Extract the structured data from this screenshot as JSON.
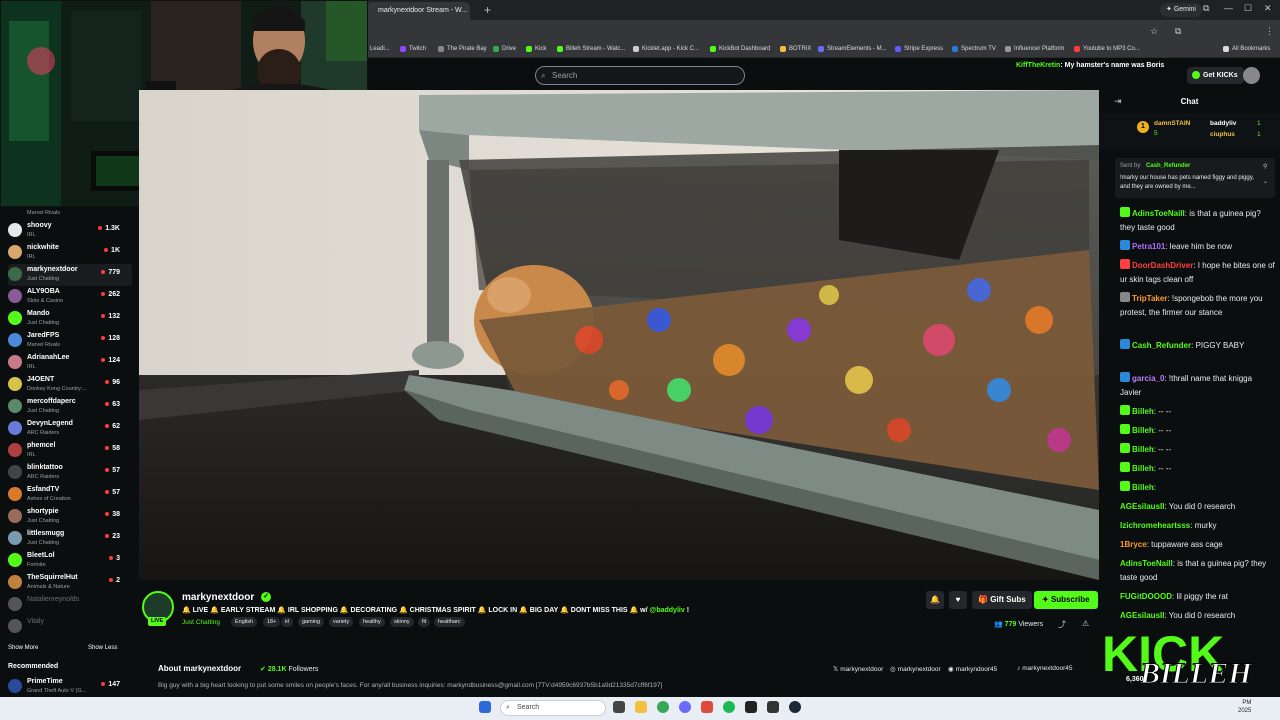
{
  "browser": {
    "tab_title": "markynextdoor Stream - W...",
    "gemini_label": "Gemini",
    "bookmarks": [
      "Leadi...",
      "Twitch",
      "The Pirate Bay",
      "Drive",
      "Kick",
      "Billeh Stream - Watc...",
      "Kicklet.app - Kick C...",
      "KickBot Dashboard",
      "BOTRIX",
      "StreamElements - M...",
      "Stripe Express",
      "Spectrum TV",
      "Influencer Platform",
      "Youtube to MP3 Co...",
      "All Bookmarks"
    ]
  },
  "kick": {
    "search_placeholder": "Search",
    "get_kicks": "Get KICKs",
    "banner_user": "KiffTheKretin",
    "banner_text": ": My hamster's name was Boris"
  },
  "sidebar": {
    "partial_category": "Marvel Rivals",
    "channels": [
      {
        "name": "shoovy",
        "category": "IRL",
        "viewers": "1.3K",
        "color": "#e8e8e8"
      },
      {
        "name": "nickwhite",
        "category": "IRL",
        "viewers": "1K",
        "color": "#d9a66b"
      },
      {
        "name": "markynextdoor",
        "category": "Just Chatting",
        "viewers": "779",
        "color": "#3a6a4a",
        "active": true
      },
      {
        "name": "ALY9OBA",
        "category": "Slots & Casino",
        "viewers": "262",
        "color": "#8a5a9a"
      },
      {
        "name": "Mando",
        "category": "Just Chatting",
        "viewers": "132",
        "color": "#53fc18"
      },
      {
        "name": "JaredFPS",
        "category": "Marvel Rivals",
        "viewers": "128",
        "color": "#4a8ad9"
      },
      {
        "name": "AdrianahLee",
        "category": "IRL",
        "viewers": "124",
        "color": "#c97a8a"
      },
      {
        "name": "J4OENT",
        "category": "Donkey Kong Country:...",
        "viewers": "96",
        "color": "#d9c24a"
      },
      {
        "name": "mercoffdaperc",
        "category": "Just Chatting",
        "viewers": "63",
        "color": "#5a8a6a"
      },
      {
        "name": "DevynLegend",
        "category": "ARC Raiders",
        "viewers": "62",
        "color": "#6a7ad9"
      },
      {
        "name": "phemcel",
        "category": "IRL",
        "viewers": "58",
        "color": "#b04040"
      },
      {
        "name": "blinktattoo",
        "category": "ARC Raiders",
        "viewers": "57",
        "color": "#444"
      },
      {
        "name": "EsfandTV",
        "category": "Ashes of Creation",
        "viewers": "57",
        "color": "#d97a2a"
      },
      {
        "name": "shortypie",
        "category": "Just Chatting",
        "viewers": "38",
        "color": "#9a6a5a"
      },
      {
        "name": "littlesmugg",
        "category": "Just Chatting",
        "viewers": "23",
        "color": "#7a9ab0"
      },
      {
        "name": "BleetLol",
        "category": "Fortnite",
        "viewers": "3",
        "color": "#53fc18"
      },
      {
        "name": "TheSquirrelHut",
        "category": "Animals & Nature",
        "viewers": "2",
        "color": "#c08040"
      },
      {
        "name": "Natalienreynolds",
        "category": "",
        "viewers": "",
        "color": "#555",
        "offline": true
      },
      {
        "name": "Vitaly",
        "category": "",
        "viewers": "",
        "color": "#555",
        "offline": true
      }
    ],
    "show_more": "Show More",
    "show_less": "Show Less",
    "recommended_title": "Recommended",
    "recommended": [
      {
        "name": "PrimeTime",
        "category": "Grand Theft Auto V (G...",
        "viewers": "147",
        "color": "#2a4a9a"
      }
    ]
  },
  "stream": {
    "username": "markynextdoor",
    "title": "🔔 LIVE 🔔 EARLY STREAM 🔔 IRL SHOPPING 🔔 DECORATING 🔔 CHRISTMAS SPIRIT 🔔 LOCK IN 🔔 BIG DAY 🔔 DONT MISS THIS 🔔 w/",
    "title_mention": "@baddyliv",
    "title_end": " !",
    "category": "Just Chatting",
    "tags": [
      "English",
      "18+",
      "irl",
      "gaming",
      "variety",
      "healthy",
      "skinny",
      "fit",
      "healtharc"
    ],
    "live_badge": "LIVE",
    "gift_subs": "Gift Subs",
    "subscribe": "Subscribe",
    "viewers_count": "779",
    "viewers_label": "Viewers"
  },
  "about": {
    "title": "About markynextdoor",
    "followers": "28.1K",
    "followers_label": "Followers",
    "bio": "Big guy with a big heart looking to put some smiles on people's faces. For any/all business inquiries: markyndbusiness@gmail.com [7TV:d4959c6937b5b1a9d21335d7cff6f197]",
    "socials": [
      "markynextdoor",
      "markynextdoor",
      "markyndoor45",
      "markynextdoor45"
    ]
  },
  "chat": {
    "title": "Chat",
    "leaderboard": [
      {
        "name": "damnSTAIN",
        "count": "5"
      },
      {
        "name": "baddyliv",
        "count": "1"
      },
      {
        "name": "ciuphus",
        "count": "1"
      }
    ],
    "pinned": {
      "sent_by_label": "Sent by",
      "sender": "Cash_Refunder",
      "text": "!marky our house has pets named figgy and piggy, and they are owned by me..."
    },
    "messages": [
      {
        "user": "AdinsToeNaill",
        "text": ": is that a guinea pig? they taste good",
        "color": "#53fc18"
      },
      {
        "user": "Petra101",
        "text": ": leave him be now",
        "color": "#b070ff"
      },
      {
        "user": "DoorDashDriver",
        "text": ": I hope he bites one of ur skin tags clean off",
        "color": "#ff4040"
      },
      {
        "user": "TripTaker",
        "text": ": !spongebob the more you protest, the firmer our stance",
        "color": "#ff9a2a"
      },
      {
        "user": "Cash_Refunder",
        "text": ": PIGGY BABY",
        "color": "#53fc18"
      },
      {
        "user": "garcia_0",
        "text": ": !thrall name that knigga Javier",
        "color": "#c07aff"
      },
      {
        "user": "Billeh",
        "text": ": -- --",
        "color": "#53fc18"
      },
      {
        "user": "Billeh",
        "text": ": -- --",
        "color": "#53fc18"
      },
      {
        "user": "Billeh",
        "text": ": -- --",
        "color": "#53fc18"
      },
      {
        "user": "Billeh",
        "text": ": -- --",
        "color": "#53fc18"
      },
      {
        "user": "Billeh",
        "text": ":",
        "color": "#53fc18"
      },
      {
        "user": "AGEsilausII",
        "text": ": You did 0 research",
        "color": "#53fc18"
      },
      {
        "user": "Izichromeheartsss",
        "text": ": murky",
        "color": "#53fc18"
      },
      {
        "user": "1Bryce",
        "text": ": tuppaware ass cage",
        "color": "#ff9a2a"
      },
      {
        "user": "AdinsToeNaill",
        "text": ": is that a guinea pig? they taste good",
        "color": "#53fc18"
      },
      {
        "user": "FUGitDOOOD",
        "text": ": lil piggy the rat",
        "color": "#53fc18"
      },
      {
        "user": "AGEsilausII",
        "text": ": You did 0 research",
        "color": "#53fc18"
      }
    ]
  },
  "overlay": {
    "kick_text": "KICK",
    "billeh_text": "BILLEH",
    "counter": "6,360"
  },
  "taskbar": {
    "search_placeholder": "Search",
    "time": "PM",
    "date": "2025"
  }
}
